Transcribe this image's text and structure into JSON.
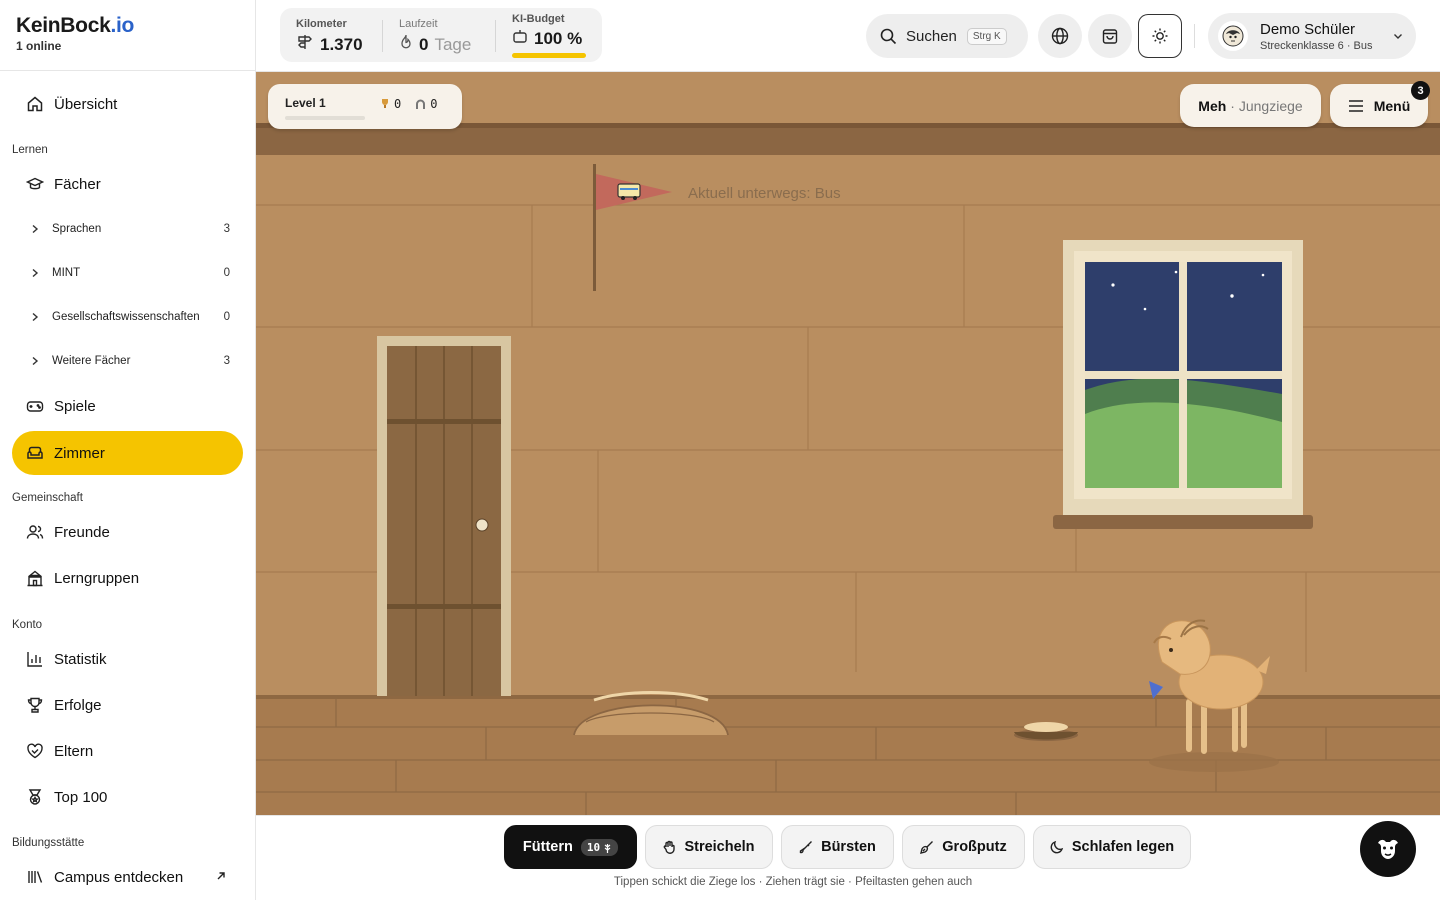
{
  "brand": {
    "name": "KeinBock",
    "tld": ".io",
    "online": "1  online"
  },
  "sidebar": {
    "overview": "Übersicht",
    "section_learn": "Lernen",
    "subjects": "Fächer",
    "sub_items": [
      {
        "label": "Sprachen",
        "count": "3"
      },
      {
        "label": "MINT",
        "count": "0"
      },
      {
        "label": "Gesellschaftswissenschaften",
        "count": "0"
      },
      {
        "label": "Weitere Fächer",
        "count": "3"
      }
    ],
    "games": "Spiele",
    "room": "Zimmer",
    "section_community": "Gemeinschaft",
    "friends": "Freunde",
    "study_groups": "Lerngruppen",
    "section_account": "Konto",
    "statistics": "Statistik",
    "achievements": "Erfolge",
    "parents": "Eltern",
    "top100": "Top 100",
    "section_education": "Bildungsstätte",
    "campus": "Campus entdecken"
  },
  "stats": {
    "km_label": "Kilometer",
    "km_value": "1.370",
    "runtime_label": "Laufzeit",
    "runtime_value": "0",
    "runtime_unit": "Tage",
    "budget_label": "KI-Budget",
    "budget_value": "100 %",
    "budget_fill": 1.0
  },
  "search": {
    "label": "Suchen",
    "shortcut": "Strg K"
  },
  "user": {
    "name": "Demo Schüler",
    "subtitle": "Streckenklasse 6 · Bus"
  },
  "scene": {
    "level": "Level 1",
    "counter1": "0",
    "counter2": "0",
    "goat_name": "Meh",
    "goat_type": "· Jungziege",
    "menu_label": "Menü",
    "menu_badge": "3",
    "flag_text": "Aktuell unterwegs: Bus",
    "colors": {
      "wall": "#b98e60",
      "floor": "#a77b4f",
      "door": "#8b6840",
      "sky": "#2e3e6b",
      "grass": "#7db663",
      "flag": "#c2695c"
    }
  },
  "actions": {
    "feed": "Füttern",
    "feed_count": "10",
    "pet": "Streicheln",
    "brush": "Bürsten",
    "clean": "Großputz",
    "sleep": "Schlafen legen",
    "hint": "Tippen schickt die Ziege los · Ziehen trägt sie · Pfeiltasten gehen auch"
  },
  "accent": "#f5c400"
}
